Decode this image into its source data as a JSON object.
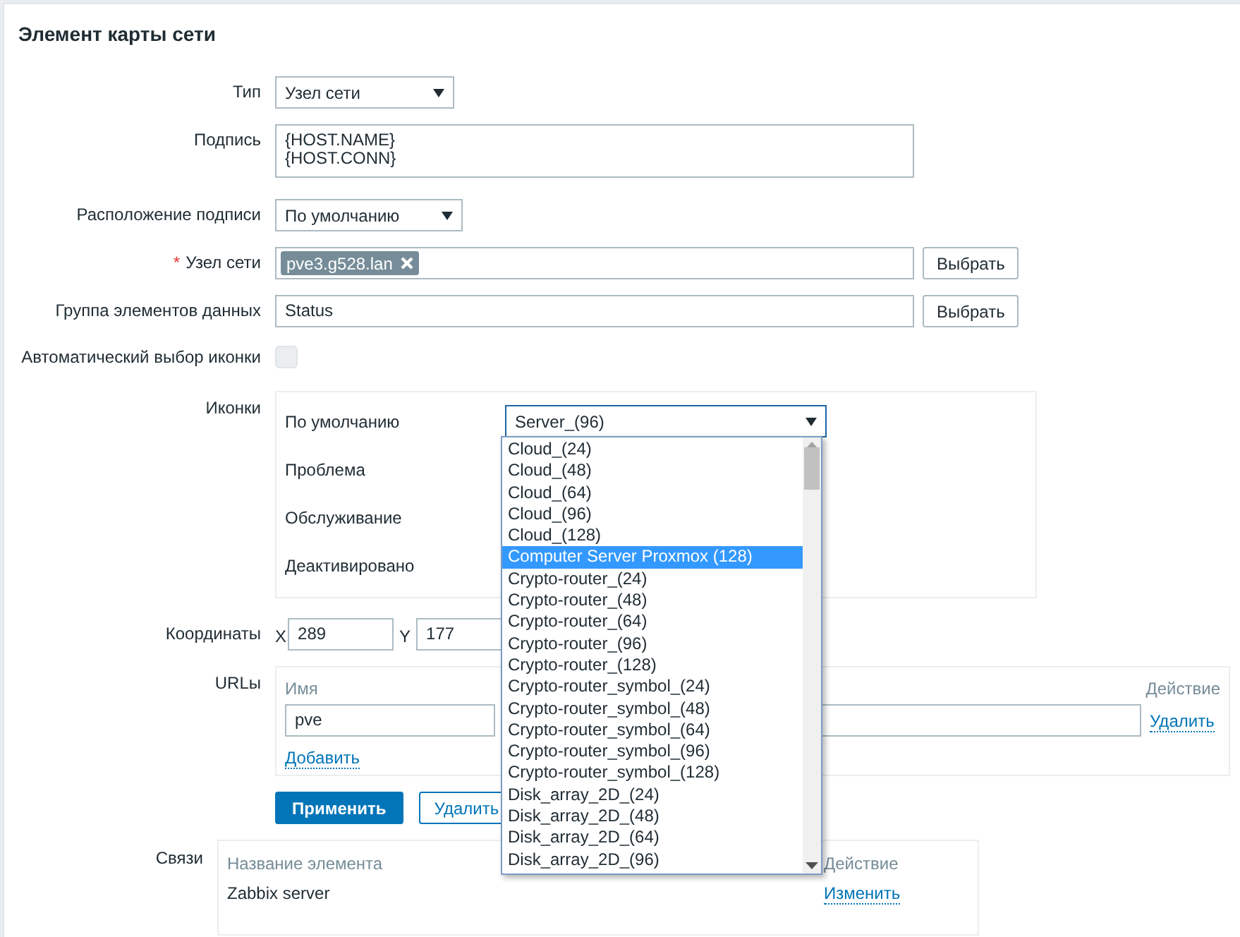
{
  "title": "Элемент карты сети",
  "type_row": {
    "label": "Тип",
    "value": "Узел сети"
  },
  "caption_row": {
    "label": "Подпись",
    "lines": [
      "{HOST.NAME}",
      "{HOST.CONN}"
    ]
  },
  "caption_position_row": {
    "label": "Расположение подписи",
    "value": "По умолчанию"
  },
  "host_row": {
    "label": "Узел сети",
    "required_mark": "*",
    "tags": [
      "pve3.g528.lan"
    ],
    "button": "Выбрать"
  },
  "item_group_row": {
    "label": "Группа элементов данных",
    "value": "Status",
    "button": "Выбрать"
  },
  "auto_icon_row": {
    "label": "Автоматический выбор иконки",
    "checked": false
  },
  "icons_row": {
    "label": "Иконки",
    "rows": [
      "По умолчанию",
      "Проблема",
      "Обслуживание",
      "Деактивировано"
    ],
    "default_value": "Server_(96)",
    "dropdown": [
      {
        "label": "Cloud_(24)",
        "selected": false
      },
      {
        "label": "Cloud_(48)",
        "selected": false
      },
      {
        "label": "Cloud_(64)",
        "selected": false
      },
      {
        "label": "Cloud_(96)",
        "selected": false
      },
      {
        "label": "Cloud_(128)",
        "selected": false
      },
      {
        "label": "Computer Server Proxmox (128)",
        "selected": true
      },
      {
        "label": "Crypto-router_(24)",
        "selected": false
      },
      {
        "label": "Crypto-router_(48)",
        "selected": false
      },
      {
        "label": "Crypto-router_(64)",
        "selected": false
      },
      {
        "label": "Crypto-router_(96)",
        "selected": false
      },
      {
        "label": "Crypto-router_(128)",
        "selected": false
      },
      {
        "label": "Crypto-router_symbol_(24)",
        "selected": false
      },
      {
        "label": "Crypto-router_symbol_(48)",
        "selected": false
      },
      {
        "label": "Crypto-router_symbol_(64)",
        "selected": false
      },
      {
        "label": "Crypto-router_symbol_(96)",
        "selected": false
      },
      {
        "label": "Crypto-router_symbol_(128)",
        "selected": false
      },
      {
        "label": "Disk_array_2D_(24)",
        "selected": false
      },
      {
        "label": "Disk_array_2D_(48)",
        "selected": false
      },
      {
        "label": "Disk_array_2D_(64)",
        "selected": false
      },
      {
        "label": "Disk_array_2D_(96)",
        "selected": false
      }
    ]
  },
  "coordinates_row": {
    "label": "Координаты",
    "x_label": "X",
    "x_value": "289",
    "y_label": "Y",
    "y_value": "177"
  },
  "urls_row": {
    "label": "URLы",
    "columns": [
      "Имя",
      "Действие"
    ],
    "rows": [
      {
        "name": "pve",
        "action": "Удалить"
      }
    ],
    "add_link": "Добавить"
  },
  "buttons": [
    "Применить",
    "Удалить"
  ],
  "links_row": {
    "label": "Связи",
    "columns": [
      "Название элемента",
      "Действие"
    ],
    "rows": [
      {
        "element": "Zabbix server",
        "action": "Изменить"
      }
    ]
  }
}
